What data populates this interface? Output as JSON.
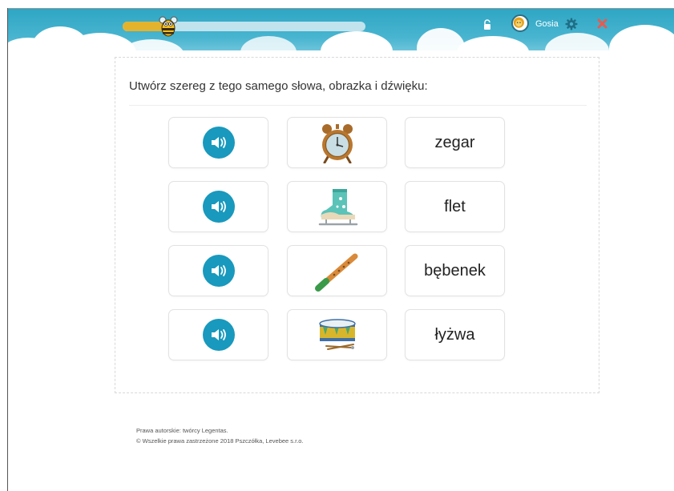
{
  "header": {
    "progress_percent": 19,
    "username": "Gosia",
    "icons": {
      "mascot": "bee-icon",
      "lock": "unlock-icon",
      "avatar": "lion-avatar-icon",
      "settings": "gear-icon",
      "close": "close-icon"
    },
    "colors": {
      "accent": "#1899bd",
      "progress": "#f6b41e",
      "close": "#e85a4f"
    }
  },
  "exercise": {
    "instruction": "Utwórz szereg z tego samego słowa, obrazka i dźwięku:",
    "sound_buttons": [
      "speaker-icon",
      "speaker-icon",
      "speaker-icon",
      "speaker-icon"
    ],
    "pictures": [
      "alarm-clock-image",
      "ice-skate-image",
      "recorder-flute-image",
      "drum-image"
    ],
    "words": [
      "zegar",
      "flet",
      "bębenek",
      "łyżwa"
    ]
  },
  "footer": {
    "line1": "Prawa autorskie: twórcy Legentas.",
    "line2": "© Wszelkie prawa zastrzeżone 2018 Pszczółka, Levebee s.r.o."
  }
}
